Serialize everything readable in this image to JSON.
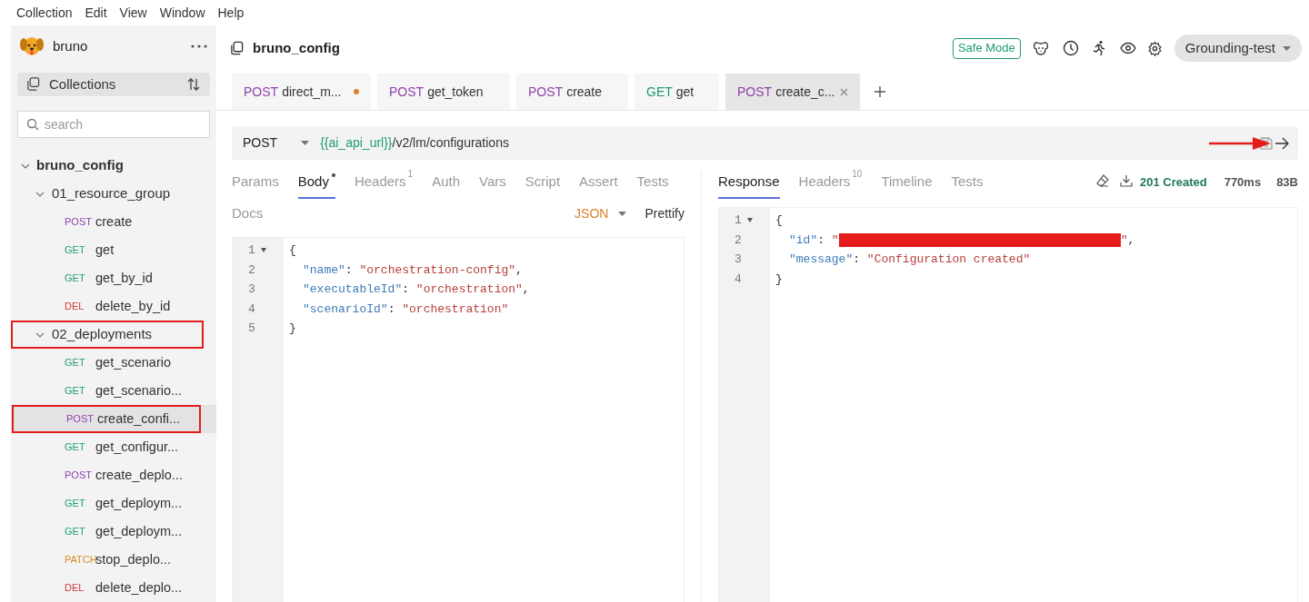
{
  "menu": [
    "Collection",
    "Edit",
    "View",
    "Window",
    "Help"
  ],
  "sidebar": {
    "app_name": "bruno",
    "collections_label": "Collections",
    "search": {
      "placeholder": "search"
    },
    "tree": [
      {
        "name": "bruno_config",
        "expanded": true,
        "children": [
          {
            "name": "01_resource_group",
            "expanded": true,
            "annotated": false,
            "children": [
              {
                "method": "POST",
                "name": "create",
                "selected": false,
                "annotated": false
              },
              {
                "method": "GET",
                "name": "get",
                "selected": false,
                "annotated": false
              },
              {
                "method": "GET",
                "name": "get_by_id",
                "selected": false,
                "annotated": false
              },
              {
                "method": "DEL",
                "name": "delete_by_id",
                "selected": false,
                "annotated": false
              }
            ]
          },
          {
            "name": "02_deployments",
            "expanded": true,
            "annotated": true,
            "children": [
              {
                "method": "GET",
                "name": "get_scenario",
                "selected": false,
                "annotated": false
              },
              {
                "method": "GET",
                "name": "get_scenario...",
                "selected": false,
                "annotated": false
              },
              {
                "method": "POST",
                "name": "create_confi...",
                "selected": true,
                "annotated": true
              },
              {
                "method": "GET",
                "name": "get_configur...",
                "selected": false,
                "annotated": false
              },
              {
                "method": "POST",
                "name": "create_deplo...",
                "selected": false,
                "annotated": false
              },
              {
                "method": "GET",
                "name": "get_deploym...",
                "selected": false,
                "annotated": false
              },
              {
                "method": "GET",
                "name": "get_deploym...",
                "selected": false,
                "annotated": false
              },
              {
                "method": "PATCH",
                "name": "stop_deplo...",
                "selected": false,
                "annotated": false
              },
              {
                "method": "DEL",
                "name": "delete_deplo...",
                "selected": false,
                "annotated": false
              }
            ]
          }
        ]
      }
    ]
  },
  "header": {
    "title": "bruno_config",
    "safe_mode": "Safe Mode",
    "environment": "Grounding-test"
  },
  "tabs": [
    {
      "method": "POST",
      "name": "direct_m...",
      "selected": false,
      "unsaved": true
    },
    {
      "method": "POST",
      "name": "get_token",
      "selected": false,
      "unsaved": false
    },
    {
      "method": "POST",
      "name": "create",
      "selected": false,
      "unsaved": false
    },
    {
      "method": "GET",
      "name": "get",
      "selected": false,
      "unsaved": false
    },
    {
      "method": "POST",
      "name": "create_c...",
      "selected": true,
      "unsaved": false
    }
  ],
  "request": {
    "method": "POST",
    "url_variable": "{{ai_api_url}}",
    "url_path": "/v2/lm/configurations",
    "send_annotated": true
  },
  "request_tabs": [
    {
      "label": "Params",
      "selected": false
    },
    {
      "label": "Body",
      "selected": true,
      "modified": true
    },
    {
      "label": "Headers",
      "count": "1",
      "selected": false
    },
    {
      "label": "Auth",
      "selected": false
    },
    {
      "label": "Vars",
      "selected": false
    },
    {
      "label": "Script",
      "selected": false
    },
    {
      "label": "Assert",
      "selected": false
    },
    {
      "label": "Tests",
      "selected": false
    },
    {
      "label": "Docs",
      "selected": false
    }
  ],
  "body_mode": "JSON",
  "prettify": "Prettify",
  "body_lines": [
    {
      "number": "1",
      "foldable": true,
      "tokens": [
        {
          "kind": "punct",
          "text": "{"
        }
      ]
    },
    {
      "number": "2",
      "foldable": false,
      "tokens": [
        {
          "kind": "key",
          "text": "\"name\""
        },
        {
          "kind": "punct",
          "text": ": "
        },
        {
          "kind": "string",
          "text": "\"orchestration-config\""
        },
        {
          "kind": "punct",
          "text": ","
        }
      ]
    },
    {
      "number": "3",
      "foldable": false,
      "tokens": [
        {
          "kind": "key",
          "text": "\"executableId\""
        },
        {
          "kind": "punct",
          "text": ": "
        },
        {
          "kind": "string",
          "text": "\"orchestration\""
        },
        {
          "kind": "punct",
          "text": ","
        }
      ]
    },
    {
      "number": "4",
      "foldable": false,
      "tokens": [
        {
          "kind": "key",
          "text": "\"scenarioId\""
        },
        {
          "kind": "punct",
          "text": ": "
        },
        {
          "kind": "string",
          "text": "\"orchestration\""
        }
      ]
    },
    {
      "number": "5",
      "foldable": false,
      "tokens": [
        {
          "kind": "punct",
          "text": "}"
        }
      ]
    }
  ],
  "response_tabs": [
    {
      "label": "Response",
      "selected": true
    },
    {
      "label": "Headers",
      "count": "10",
      "selected": false
    },
    {
      "label": "Timeline",
      "selected": false
    },
    {
      "label": "Tests",
      "selected": false
    }
  ],
  "status": "201 Created",
  "time": "770ms",
  "size": "83B",
  "response_lines": [
    {
      "number": "1",
      "foldable": true,
      "tokens": [
        {
          "kind": "punct",
          "text": "{"
        }
      ]
    },
    {
      "number": "2",
      "foldable": false,
      "tokens": [
        {
          "kind": "key",
          "text": "\"id\""
        },
        {
          "kind": "punct",
          "text": ": "
        },
        {
          "kind": "string",
          "text": "\""
        },
        {
          "kind": "redacted"
        },
        {
          "kind": "string",
          "text": "\""
        },
        {
          "kind": "punct",
          "text": ","
        }
      ]
    },
    {
      "number": "3",
      "foldable": false,
      "tokens": [
        {
          "kind": "key",
          "text": "\"message\""
        },
        {
          "kind": "punct",
          "text": ": "
        },
        {
          "kind": "string",
          "text": "\"Configuration created\""
        }
      ]
    },
    {
      "number": "4",
      "foldable": false,
      "tokens": [
        {
          "kind": "punct",
          "text": "}"
        }
      ]
    }
  ]
}
